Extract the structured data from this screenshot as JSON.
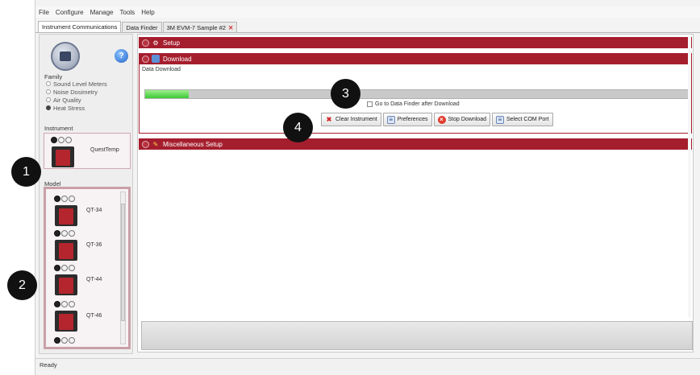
{
  "menu": [
    "File",
    "Configure",
    "Manage",
    "Tools",
    "Help"
  ],
  "tabs": [
    {
      "label": "Instrument Communications",
      "active": true
    },
    {
      "label": "Data Finder",
      "active": false
    },
    {
      "label": "3M EVM-7 Sample #2",
      "active": false,
      "closable": true
    }
  ],
  "left": {
    "family_label": "Family",
    "family_options": [
      {
        "label": "Sound Level Meters",
        "checked": false
      },
      {
        "label": "Noise Dosimetry",
        "checked": false
      },
      {
        "label": "Air Quality",
        "checked": false
      },
      {
        "label": "Heat Stress",
        "checked": true
      }
    ],
    "instrument_label": "Instrument",
    "instrument_name": "QuestTemp",
    "model_label": "Model",
    "models": [
      "QT-34",
      "QT-36",
      "QT-44",
      "QT-46"
    ]
  },
  "sections": {
    "setup": "Setup",
    "download": "Download",
    "misc": "Miscellaneous Setup"
  },
  "download": {
    "data_label": "Data Download",
    "progress": 0.08,
    "goto_label": "Go to Data Finder after Download",
    "buttons": [
      "Clear Instrument",
      "Preferences",
      "Stop Download",
      "Select COM Port"
    ]
  },
  "status": "Ready",
  "callouts": [
    "1",
    "2",
    "3",
    "4"
  ],
  "colors": {
    "accent": "#a51e2e",
    "progress": "#4fd443"
  }
}
